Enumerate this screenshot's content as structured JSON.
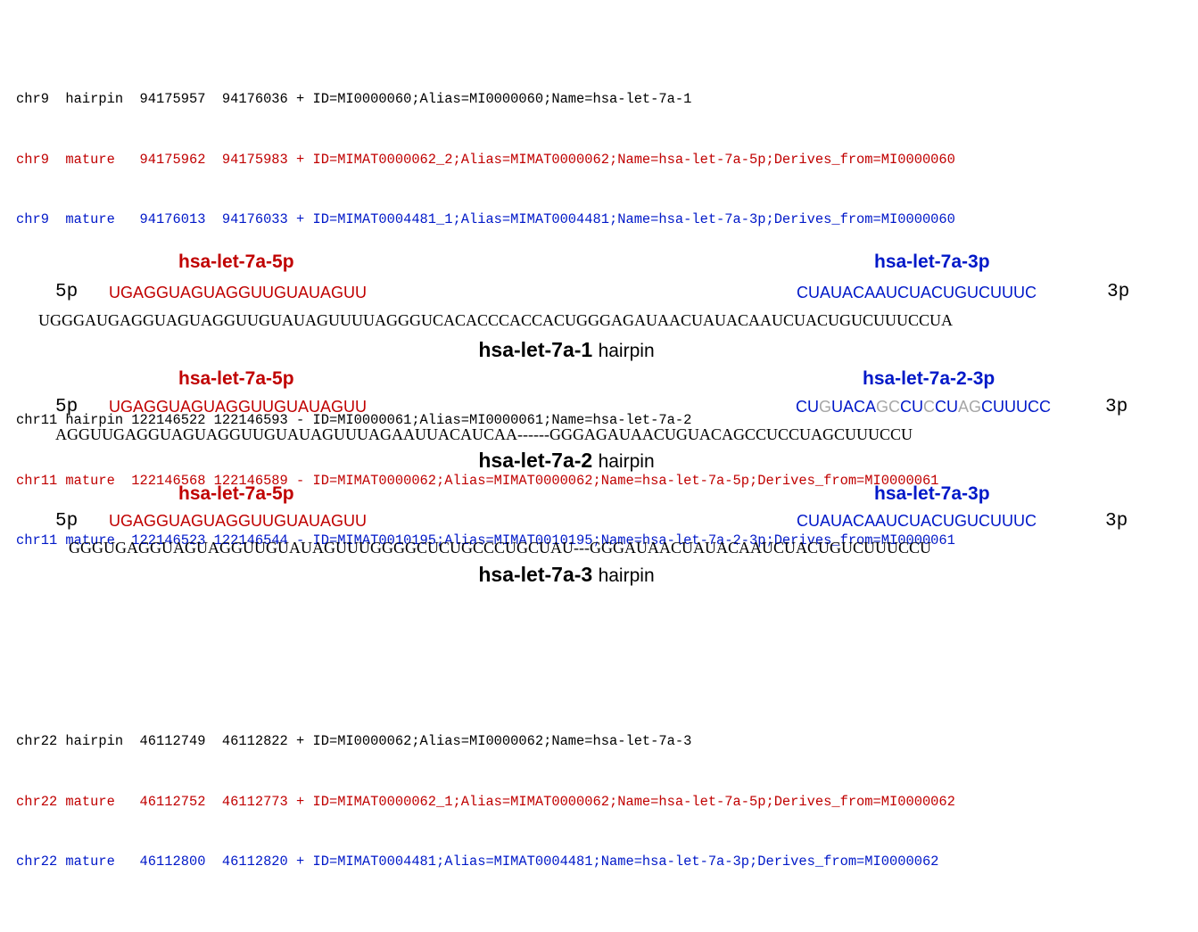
{
  "gff_records": [
    [
      {
        "text": "chr9  hairpin  94175957  94176036 + ID=MI0000060;Alias=MI0000060;Name=hsa-let-7a-1",
        "color": "#000000"
      },
      {
        "text": "chr9  mature   94175962  94175983 + ID=MIMAT0000062_2;Alias=MIMAT0000062;Name=hsa-let-7a-5p;Derives_from=MI0000060",
        "color": "#c00000"
      },
      {
        "text": "chr9  mature   94176013  94176033 + ID=MIMAT0004481_1;Alias=MIMAT0004481;Name=hsa-let-7a-3p;Derives_from=MI0000060",
        "color": "#0018c8"
      }
    ],
    [
      {
        "text": "chr11 hairpin 122146522 122146593 - ID=MI0000061;Alias=MI0000061;Name=hsa-let-7a-2",
        "color": "#000000"
      },
      {
        "text": "chr11 mature  122146568 122146589 - ID=MIMAT0000062;Alias=MIMAT0000062;Name=hsa-let-7a-5p;Derives_from=MI0000061",
        "color": "#c00000"
      },
      {
        "text": "chr11 mature  122146523 122146544 - ID=MIMAT0010195;Alias=MIMAT0010195;Name=hsa-let-7a-2-3p;Derives_from=MI0000061",
        "color": "#0018c8"
      }
    ],
    [
      {
        "text": "chr22 hairpin  46112749  46112822 + ID=MI0000062;Alias=MI0000062;Name=hsa-let-7a-3",
        "color": "#000000"
      },
      {
        "text": "chr22 mature   46112752  46112773 + ID=MIMAT0000062_1;Alias=MIMAT0000062;Name=hsa-let-7a-5p;Derives_from=MI0000062",
        "color": "#c00000"
      },
      {
        "text": "chr22 mature   46112800  46112820 + ID=MIMAT0004481;Alias=MIMAT0004481;Name=hsa-let-7a-3p;Derives_from=MI0000062",
        "color": "#0018c8"
      }
    ]
  ],
  "diagrams": [
    {
      "label5": "hsa-let-7a-5p",
      "label3": "hsa-let-7a-3p",
      "end5": "5p",
      "end3": "3p",
      "seq5": "UGAGGUAGUAGGUUGUAUAGUU",
      "seq3": [
        {
          "t": "CUAUACAAUCUACUGUCUUUC",
          "c": "#0018c8"
        }
      ],
      "hairpin": "UGGGAUGAGGUAGUAGGUUGUAUAGUUUUAGGGUCACACCCACCACUGGGAGAUAACUAUACAAUCUACUGUCUUUCCUA",
      "title_bold": "hsa-let-7a-1",
      "title_suffix": "hairpin",
      "color5": "#c00000",
      "color3": "#0018c8"
    },
    {
      "label5": "hsa-let-7a-5p",
      "label3": "hsa-let-7a-2-3p",
      "end5": "5p",
      "end3": "3p",
      "seq5": "UGAGGUAGUAGGUUGUAUAGUU",
      "seq3": [
        {
          "t": "CU",
          "c": "#0018c8"
        },
        {
          "t": "G",
          "c": "#a6a6a6"
        },
        {
          "t": "UACA",
          "c": "#0018c8"
        },
        {
          "t": "GC",
          "c": "#a6a6a6"
        },
        {
          "t": "CU",
          "c": "#0018c8"
        },
        {
          "t": "C",
          "c": "#a6a6a6"
        },
        {
          "t": "CU",
          "c": "#0018c8"
        },
        {
          "t": "AG",
          "c": "#a6a6a6"
        },
        {
          "t": "CUUUCC",
          "c": "#0018c8"
        }
      ],
      "hairpin": "AGGUUGAGGUAGUAGGUUGUAUAGUUUAGAAUUACAUCAA------GGGAGAUAACUGUACAGCCUCCUAGCUUUCCU",
      "title_bold": "hsa-let-7a-2",
      "title_suffix": "hairpin",
      "color5": "#c00000",
      "color3": "#0018c8"
    },
    {
      "label5": "hsa-let-7a-5p",
      "label3": "hsa-let-7a-3p",
      "end5": "5p",
      "end3": "3p",
      "seq5": "UGAGGUAGUAGGUUGUAUAGUU",
      "seq3": [
        {
          "t": "CUAUACAAUCUACUGUCUUUC",
          "c": "#0018c8"
        }
      ],
      "hairpin": "GGGUGAGGUAGUAGGUUGUAUAGUUUGGGGCUCUGCCCUGCUAU---GGGAUAACUAUACAAUCUACUGUCUUUCCU",
      "title_bold": "hsa-let-7a-3",
      "title_suffix": "hairpin",
      "color5": "#c00000",
      "color3": "#0018c8"
    }
  ]
}
